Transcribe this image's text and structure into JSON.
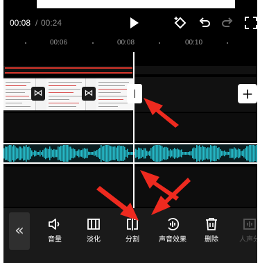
{
  "player": {
    "current_time": "00:08",
    "separator": "/",
    "total_time": "00:24",
    "controls": [
      "play-icon",
      "keyframe-icon",
      "undo-icon",
      "redo-icon",
      "fullscreen-icon"
    ]
  },
  "ruler": {
    "labels": [
      "00:06",
      "00:08",
      "00:10"
    ]
  },
  "timeline": {
    "add_symbol": "+",
    "transition_symbol": "⋈",
    "accent_colors": {
      "audio": "#26b8c6",
      "effect_line": "#d8362b",
      "arrow": "#ee2a1f"
    }
  },
  "toolbar": {
    "back_symbol": "«",
    "items": [
      {
        "label": "音量",
        "icon": "volume-icon"
      },
      {
        "label": "淡化",
        "icon": "fade-icon"
      },
      {
        "label": "分割",
        "icon": "split-icon"
      },
      {
        "label": "声音效果",
        "icon": "sound-effect-icon"
      },
      {
        "label": "删除",
        "icon": "delete-icon"
      },
      {
        "label": "人声分",
        "icon": "voice-separate-icon"
      }
    ]
  }
}
